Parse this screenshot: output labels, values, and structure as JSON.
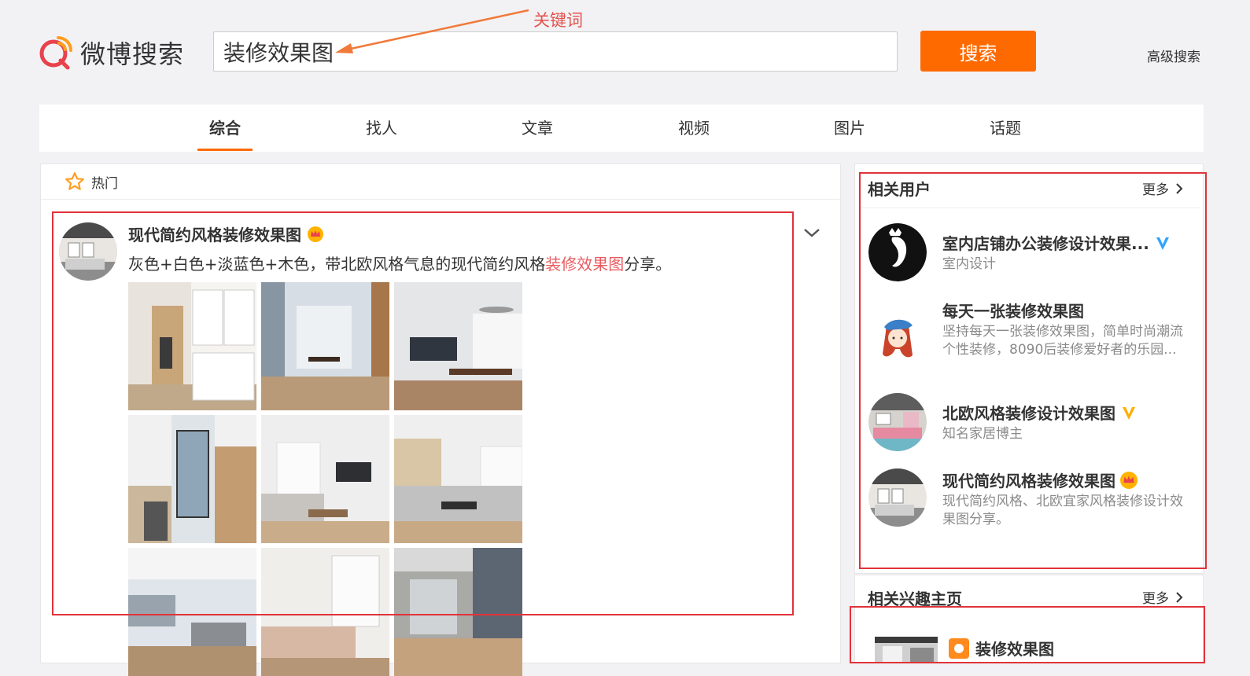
{
  "header": {
    "logo_text": "微博搜索",
    "search_value": "装修效果图",
    "search_button": "搜索",
    "advanced_search": "高级搜索",
    "annotation": "关键词"
  },
  "tabs": [
    {
      "label": "综合",
      "active": true
    },
    {
      "label": "找人"
    },
    {
      "label": "文章"
    },
    {
      "label": "视频"
    },
    {
      "label": "图片"
    },
    {
      "label": "话题"
    }
  ],
  "feed": {
    "section_label": "热门",
    "post": {
      "author": "现代简约风格装修效果图",
      "text_before": "灰色+白色+淡蓝色+木色，带北欧风格气息的现代简约风格",
      "text_highlight": "装修效果图",
      "text_after": "分享。"
    }
  },
  "related_users": {
    "title": "相关用户",
    "more": "更多",
    "users": [
      {
        "name": "室内店铺办公装修设计效果...",
        "desc": "室内设计",
        "badge": "blue-v"
      },
      {
        "name": "每天一张装修效果图",
        "desc": "坚持每天一张装修效果图，简单时尚潮流个性装修，8090后装修爱好者的乐园..."
      },
      {
        "name": "北欧风格装修设计效果图",
        "desc": "知名家居博主",
        "badge": "yellow-v"
      },
      {
        "name": "现代简约风格装修效果图",
        "desc": "现代简约风格、北欧宜家风格装修设计效果图分享。",
        "badge": "crown"
      }
    ]
  },
  "related_pages": {
    "title": "相关兴趣主页",
    "more": "更多",
    "first_item": "装修效果图"
  },
  "colors": {
    "accent": "#ff6a00",
    "highlight": "#e85c61",
    "annotation_red": "#e0333a",
    "verified_blue": "#2fa4ff",
    "verified_yellow": "#ffae00"
  }
}
